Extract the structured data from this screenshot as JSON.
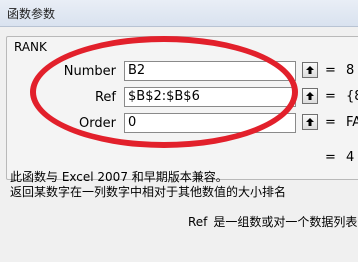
{
  "dialog": {
    "title": "函数参数",
    "function_name": "RANK",
    "args": [
      {
        "label": "Number",
        "value": "B2",
        "result": "8"
      },
      {
        "label": "Ref",
        "value": "$B$2:$B$6",
        "result": "{8"
      },
      {
        "label": "Order",
        "value": "0",
        "result": "FA"
      }
    ],
    "overall_result": "4",
    "desc_line1": "此函数与 Excel 2007 和早期版本兼容。",
    "desc_line2": "返回某数字在一列数字中相对于其他数值的大小排名",
    "arg_desc_name": "Ref",
    "arg_desc_text": "是一组数或对一个数据列表",
    "collapse_icon": "range-select-arrow-icon",
    "accent_color": "#e2202b"
  }
}
